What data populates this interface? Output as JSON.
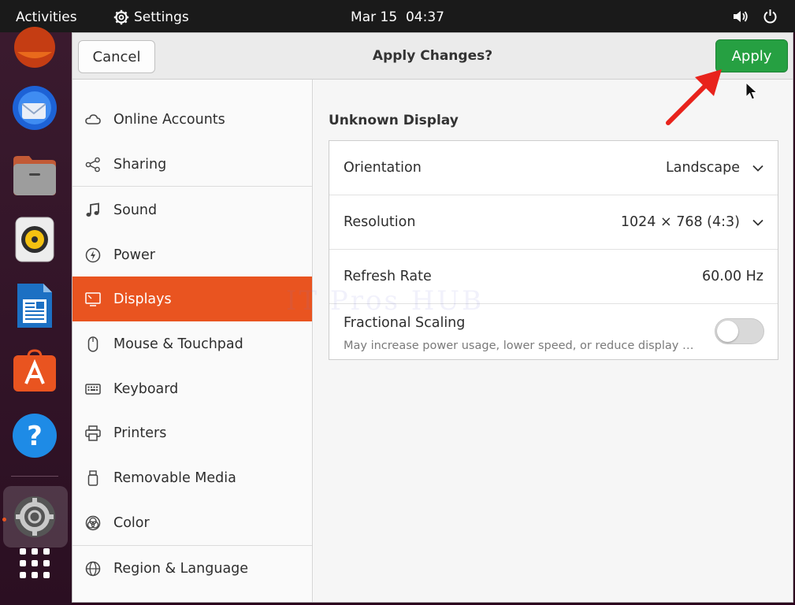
{
  "topbar": {
    "activities": "Activities",
    "app_name": "Settings",
    "date": "Mar 15",
    "time": "04:37"
  },
  "dock": {
    "items": [
      "firefox-icon",
      "thunderbird-icon",
      "files-icon",
      "rhythmbox-icon",
      "libreoffice-writer-icon",
      "app-center-icon",
      "help-icon",
      "settings-icon",
      "show-apps-icon"
    ]
  },
  "header": {
    "cancel_label": "Cancel",
    "title": "Apply Changes?",
    "apply_label": "Apply"
  },
  "sidebar": {
    "items": [
      {
        "label": "Online Accounts",
        "icon": "cloud-icon"
      },
      {
        "label": "Sharing",
        "icon": "share-icon"
      },
      {
        "label": "Sound",
        "icon": "music-note-icon"
      },
      {
        "label": "Power",
        "icon": "power-icon"
      },
      {
        "label": "Displays",
        "icon": "display-icon",
        "active": true
      },
      {
        "label": "Mouse & Touchpad",
        "icon": "mouse-icon"
      },
      {
        "label": "Keyboard",
        "icon": "keyboard-icon"
      },
      {
        "label": "Printers",
        "icon": "printer-icon"
      },
      {
        "label": "Removable Media",
        "icon": "usb-drive-icon"
      },
      {
        "label": "Color",
        "icon": "color-icon"
      },
      {
        "label": "Region & Language",
        "icon": "globe-icon"
      }
    ]
  },
  "content": {
    "section_title": "Unknown Display",
    "orientation": {
      "label": "Orientation",
      "value": "Landscape"
    },
    "resolution": {
      "label": "Resolution",
      "value": "1024 × 768 (4:3)"
    },
    "refresh": {
      "label": "Refresh Rate",
      "value": "60.00 Hz"
    },
    "scaling": {
      "label": "Fractional Scaling",
      "description": "May increase power usage, lower speed, or reduce display sharpness.",
      "enabled": false
    }
  },
  "watermark": "IT Pros HUB",
  "colors": {
    "accent": "#e95420",
    "apply_green": "#26a042",
    "annotation_arrow": "#e8231c"
  }
}
